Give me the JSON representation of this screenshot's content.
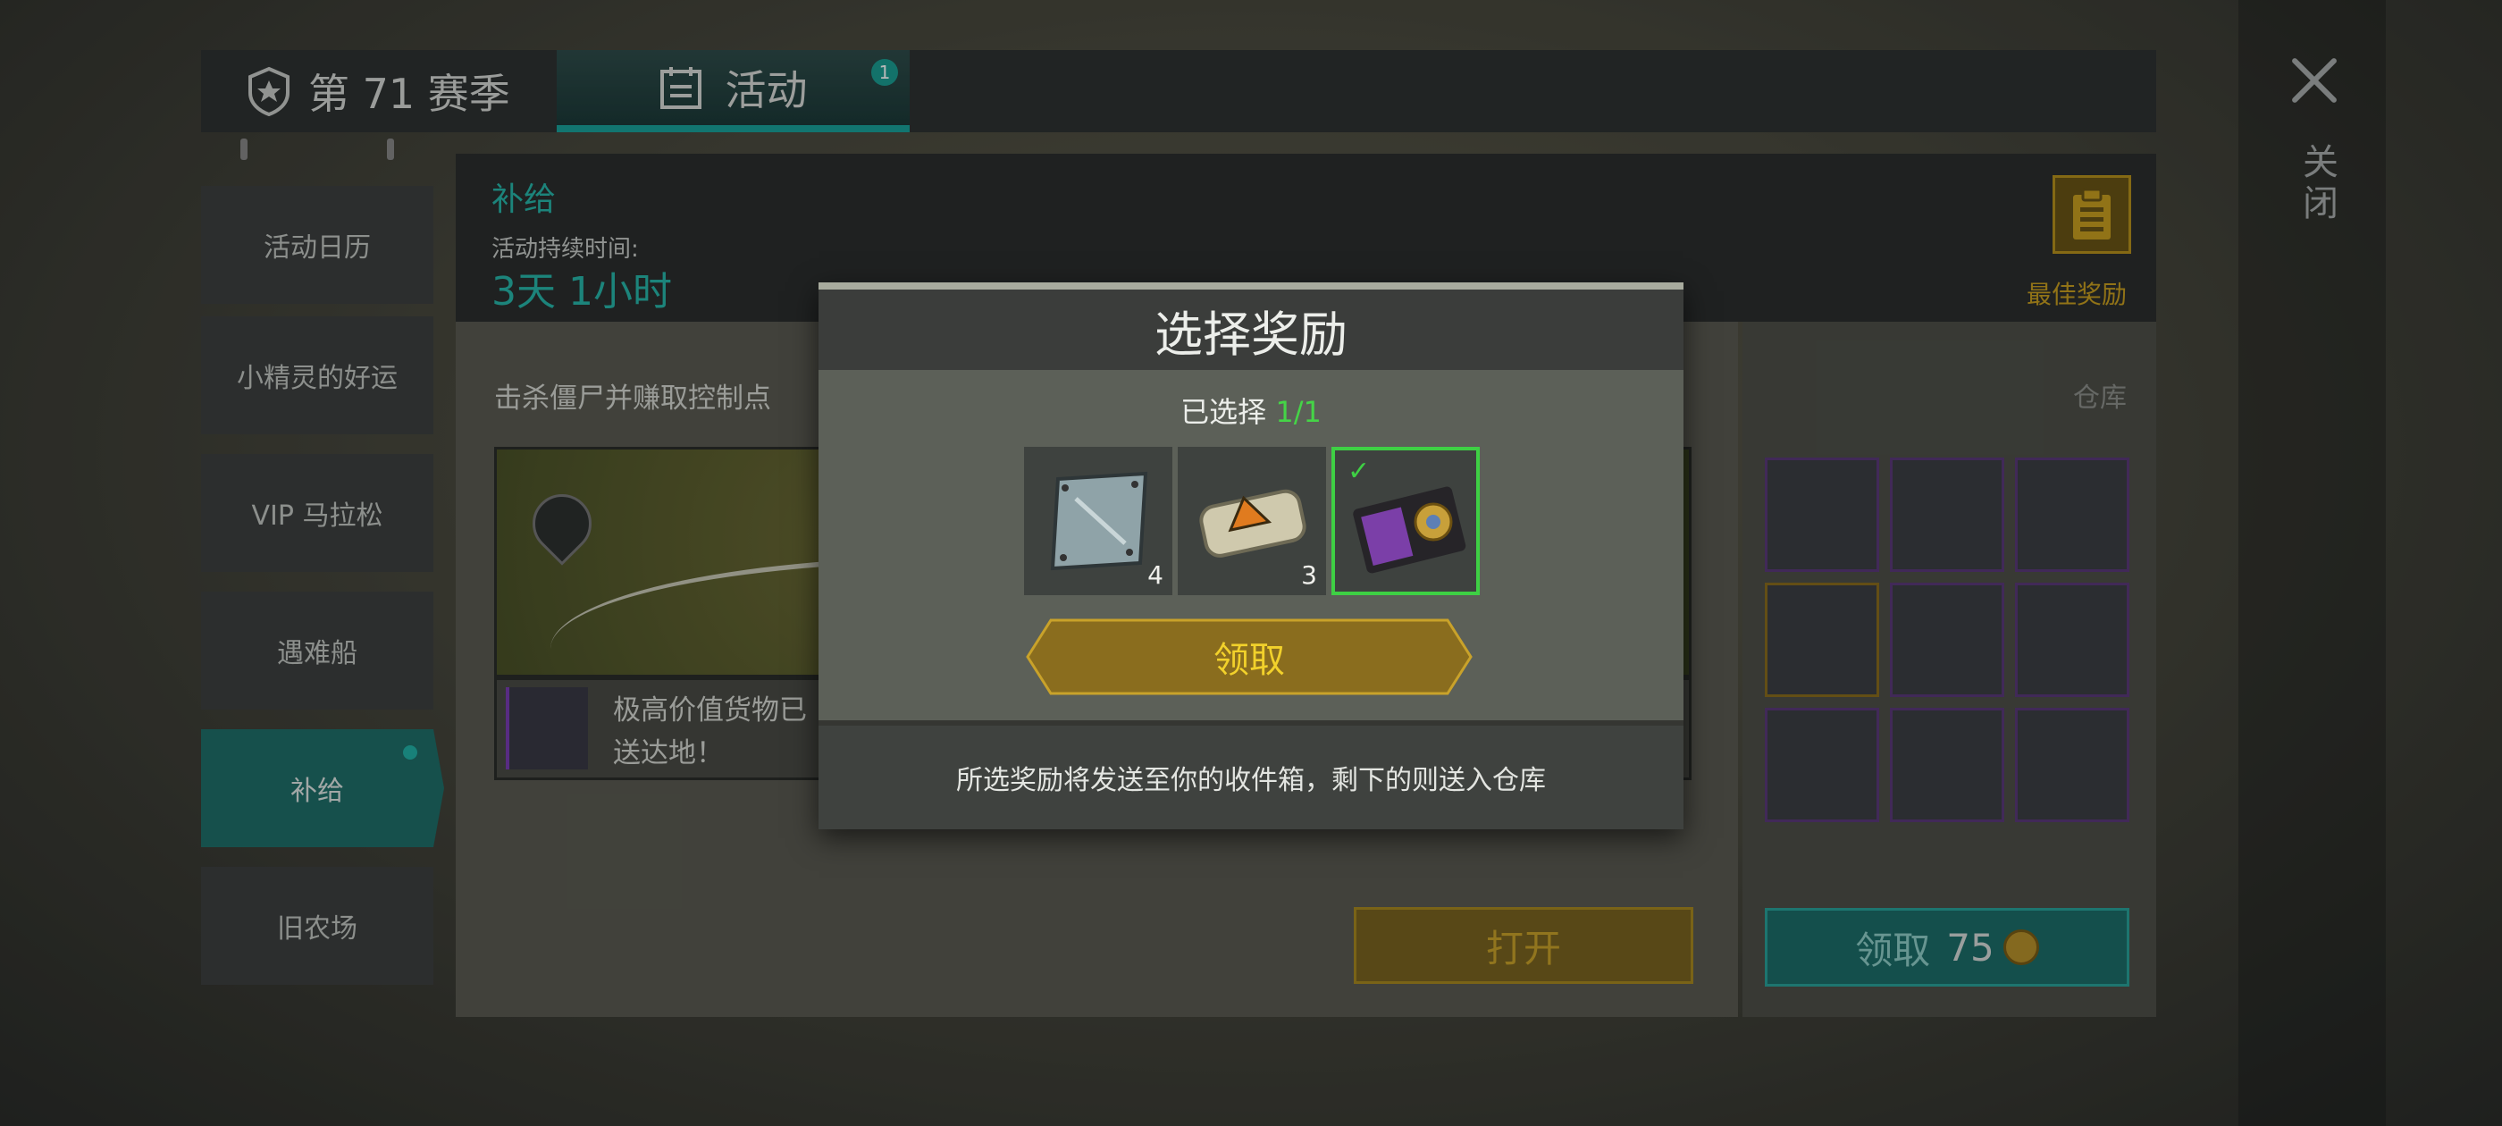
{
  "tabs": {
    "season_label": "第 71 赛季",
    "event_label": "活动",
    "event_badge": "1"
  },
  "close": {
    "label": "关闭"
  },
  "sidebar": {
    "items": [
      {
        "label": "活动日历",
        "active": false
      },
      {
        "label": "小精灵的好运",
        "active": false
      },
      {
        "label": "VIP 马拉松",
        "active": false
      },
      {
        "label": "遇难船",
        "active": false
      },
      {
        "label": "补给",
        "active": true
      },
      {
        "label": "旧农场",
        "active": false
      }
    ]
  },
  "event": {
    "title": "补给",
    "duration_label": "活动持续时间:",
    "duration_value": "3天 1小时",
    "best_rewards_label": "最佳奖励",
    "task_text": "击杀僵尸并赚取控制点",
    "cargo_text": "极高价值货物已送达地！",
    "open_button": "打开"
  },
  "warehouse": {
    "label": "仓库",
    "items": [
      {
        "icon": "rifle-icon",
        "rarity": "purple"
      },
      {
        "icon": "boots-icon",
        "rarity": "purple"
      },
      {
        "icon": "medkit-bag-icon",
        "rarity": "purple"
      },
      {
        "icon": "pistol-icon",
        "rarity": "gold"
      },
      {
        "icon": "assault-rifle-icon",
        "rarity": "purple"
      },
      {
        "icon": "syringe-icon",
        "rarity": "purple"
      },
      {
        "icon": "armor-vest-icon",
        "rarity": "purple"
      },
      {
        "icon": "sniper-rifle-icon",
        "rarity": "purple"
      },
      {
        "icon": "syringe-icon",
        "rarity": "purple"
      }
    ],
    "claim_label": "领取",
    "claim_cost": "75"
  },
  "modal": {
    "title": "选择奖励",
    "selected_prefix": "已选择 ",
    "selected_count": "1/1",
    "rewards": [
      {
        "icon": "steel-plate-icon",
        "qty": "4",
        "selected": false
      },
      {
        "icon": "explosive-clay-icon",
        "qty": "3",
        "selected": false
      },
      {
        "icon": "badge-wallet-icon",
        "qty": "",
        "selected": true
      }
    ],
    "claim_button": "领取",
    "footer_note": "所选奖励将发送至你的收件箱，剩下的则送入仓库"
  },
  "colors": {
    "accent_teal": "#27b7ab",
    "gold": "#c9a021",
    "selected_green": "#3ed044"
  }
}
